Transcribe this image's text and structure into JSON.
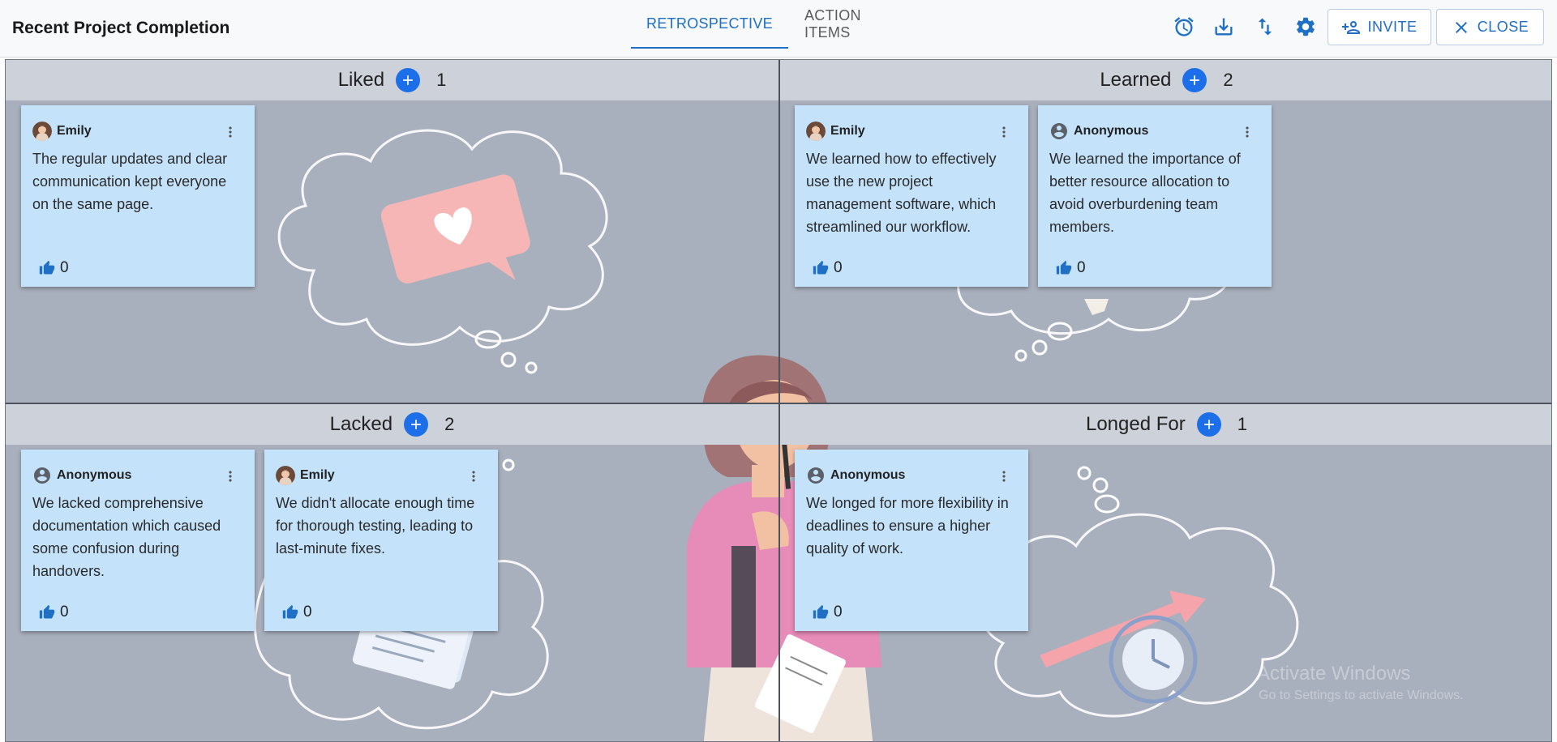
{
  "header": {
    "title": "Recent Project Completion",
    "tabs": [
      {
        "label": "RETROSPECTIVE",
        "active": true
      },
      {
        "label": "ACTION ITEMS",
        "active": false
      }
    ],
    "icons": [
      "alarm-icon",
      "download-icon",
      "sort-icon",
      "gear-icon"
    ],
    "invite_label": "INVITE",
    "close_label": "CLOSE"
  },
  "colors": {
    "accent": "#1f6fc5",
    "add_button": "#1c6fe8",
    "card_bg": "#c4e3fb",
    "board_bg": "#a9b0bd",
    "section_header_bg": "#cdd1da"
  },
  "sections": [
    {
      "name": "Liked",
      "count": "1",
      "cards": [
        {
          "author": "Emily",
          "avatar": "photo",
          "text": "The regular updates and clear communication kept everyone on the same page.",
          "likes": "0"
        }
      ]
    },
    {
      "name": "Learned",
      "count": "2",
      "cards": [
        {
          "author": "Emily",
          "avatar": "photo",
          "text": "We learned how to effectively use the new project management software, which streamlined our workflow.",
          "likes": "0"
        },
        {
          "author": "Anonymous",
          "avatar": "person-icon",
          "text": "We learned the importance of better resource allocation to avoid overburdening team members.",
          "likes": "0"
        }
      ]
    },
    {
      "name": "Lacked",
      "count": "2",
      "cards": [
        {
          "author": "Anonymous",
          "avatar": "person-icon",
          "text": "We lacked comprehensive documentation which caused some confusion during handovers.",
          "likes": "0"
        },
        {
          "author": "Emily",
          "avatar": "photo",
          "text": "We didn't allocate enough time for thorough testing, leading to last-minute fixes.",
          "likes": "0"
        }
      ]
    },
    {
      "name": "Longed For",
      "count": "1",
      "cards": [
        {
          "author": "Anonymous",
          "avatar": "person-icon",
          "text": "We longed for more flexibility in deadlines to ensure a higher quality of work.",
          "likes": "0"
        }
      ]
    }
  ],
  "os_watermark": {
    "line1": "Activate Windows",
    "line2": "Go to Settings to activate Windows."
  }
}
